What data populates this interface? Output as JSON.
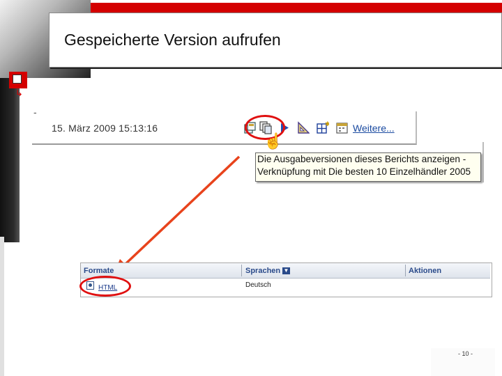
{
  "slide": {
    "title": "Gespeicherte Version aufrufen",
    "page_number": "- 10 -"
  },
  "report_toolbar": {
    "timestamp": "15. März 2009 15:13:16",
    "more_link": "Weitere...",
    "icons": [
      "save-report-icon",
      "output-versions-icon",
      "run-icon",
      "triangle-ruler-icon",
      "grid-add-icon",
      "calendar-schedule-icon"
    ]
  },
  "tooltip": {
    "line1": "Die Ausgabeversionen dieses Berichts anzeigen -",
    "line2": "Verknüpfung mit Die besten 10 Einzelhändler 2005"
  },
  "versions_table": {
    "columns": [
      "Formate",
      "Sprachen",
      "Aktionen"
    ],
    "rows": [
      {
        "format": "HTML",
        "language": "Deutsch",
        "actions": ""
      }
    ]
  },
  "colors": {
    "accent_red": "#d40000",
    "highlight_red": "#e01010",
    "link_blue": "#1a4aa0"
  }
}
